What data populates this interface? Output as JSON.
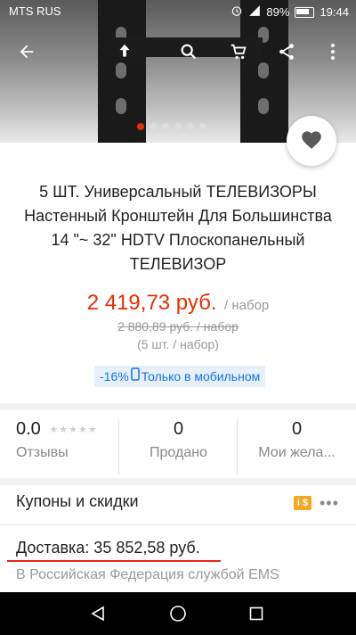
{
  "status_bar": {
    "carrier": "MTS RUS",
    "battery": "89%",
    "time": "19:44"
  },
  "toolbar": {
    "icons": [
      "back-arrow-icon",
      "share-upload-icon",
      "search-icon",
      "cart-icon",
      "share-icon",
      "more-vert-icon"
    ]
  },
  "gallery": {
    "image_count": 6,
    "active_index": 0
  },
  "product": {
    "title": "5 ШТ. Универсальный ТЕЛЕВИЗОРЫ Настенный Кронштейн Для Большинства 14 \"~ 32\" HDTV Плоскопанельный ТЕЛЕВИЗОР",
    "price": "2 419,73 руб.",
    "price_unit": "/ набор",
    "old_price": "2 880,89 руб. / набор",
    "pack_info": "(5 шт. / набор)",
    "discount_badge": "-16%",
    "mobile_only_label": "Только в мобильном"
  },
  "stats": {
    "rating_value": "0.0",
    "reviews_label": "Отзывы",
    "sold_value": "0",
    "sold_label": "Продано",
    "wishlist_value": "0",
    "wishlist_label": "Мои жела..."
  },
  "coupons": {
    "label": "Купоны и скидки",
    "icon_text": "i $"
  },
  "shipping": {
    "label": "Доставка: 35 852,58 руб.",
    "sub": "В Российская Федерация службой EMS"
  },
  "colors": {
    "accent": "#e62e04",
    "badge_bg": "#e5f0fb",
    "badge_text": "#1a73e8",
    "underline": "#e8261b"
  }
}
